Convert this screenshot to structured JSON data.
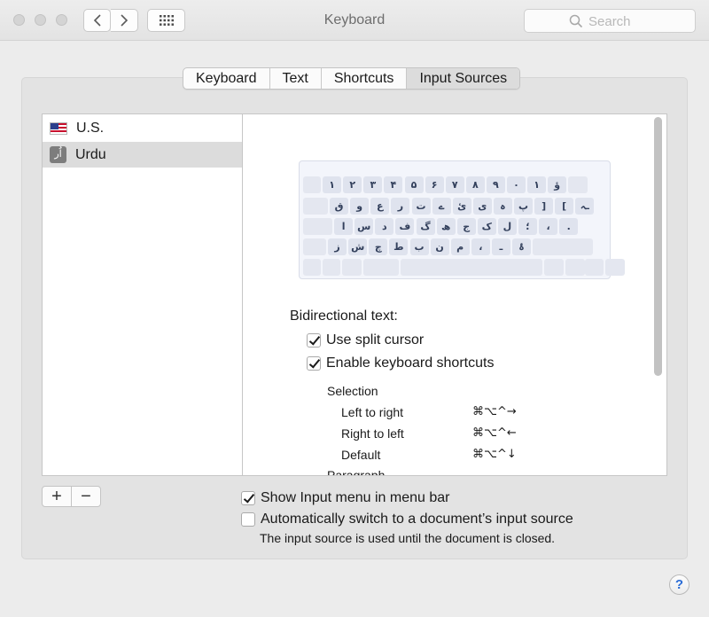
{
  "window": {
    "title": "Keyboard",
    "search_placeholder": "Search"
  },
  "tabs": [
    {
      "label": "Keyboard"
    },
    {
      "label": "Text"
    },
    {
      "label": "Shortcuts"
    },
    {
      "label": "Input Sources",
      "active": true
    }
  ],
  "sources": [
    {
      "label": "U.S.",
      "icon": "us-flag-icon",
      "selected": false
    },
    {
      "label": "Urdu",
      "icon_text": "اُر",
      "icon": "urdu-input-icon",
      "selected": true
    }
  ],
  "keyboard_rows": [
    [
      "",
      "۱",
      "۲",
      "۳",
      "۴",
      "۵",
      "۶",
      "۷",
      "۸",
      "۹",
      "۰",
      "۱",
      "ؤ",
      ""
    ],
    [
      "",
      "ق",
      "و",
      "ع",
      "ر",
      "ت",
      "ے",
      "ئ",
      "ی",
      "ہ",
      "پ",
      "]",
      "[",
      "ـہ"
    ],
    [
      "",
      "ا",
      "س",
      "د",
      "ف",
      "گ",
      "ھ",
      "ج",
      "ک",
      "ل",
      "؛",
      "،",
      "."
    ],
    [
      "",
      "ز",
      "ش",
      "چ",
      "ط",
      "ب",
      "ن",
      "م",
      "،",
      "ـ",
      "ۂ",
      ""
    ]
  ],
  "bidi": {
    "heading": "Bidirectional text:",
    "split_cursor": {
      "label": "Use split cursor",
      "checked": true
    },
    "keyboard_shortcuts": {
      "label": "Enable keyboard shortcuts",
      "checked": true
    },
    "selection_heading": "Selection",
    "shortcuts": [
      {
        "label": "Left to right",
        "keys": "⌘⌥^→"
      },
      {
        "label": "Right to left",
        "keys": "⌘⌥^←"
      },
      {
        "label": "Default",
        "keys": "⌘⌥^↓"
      }
    ],
    "paragraph_heading": "Paragraph"
  },
  "options": {
    "show_menu": {
      "label": "Show Input menu in menu bar",
      "checked": true
    },
    "auto_switch": {
      "label": "Automatically switch to a document’s input source",
      "checked": false
    },
    "note": "The input source is used until the document is closed."
  },
  "buttons": {
    "add": "+",
    "remove": "−",
    "help": "?"
  },
  "colors": {
    "selection": "#dcdcdc",
    "key": "#dfe3ee",
    "key_text": "#33405c",
    "help_accent": "#2a6cd6"
  }
}
